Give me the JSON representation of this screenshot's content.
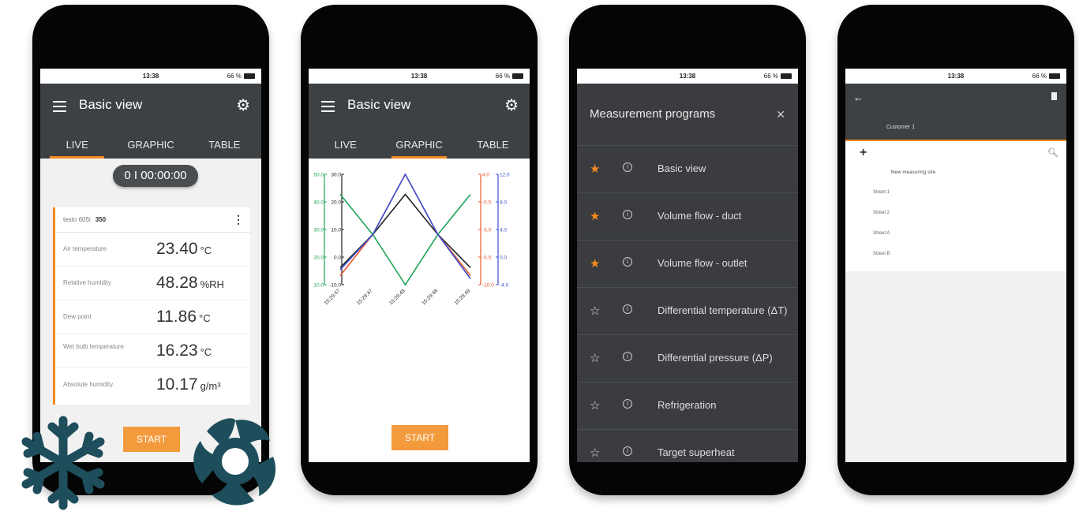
{
  "status": {
    "time": "13:38",
    "battery": "66 %"
  },
  "phone1": {
    "title": "Basic view",
    "tabs": [
      "LIVE",
      "GRAPHIC",
      "TABLE"
    ],
    "timer": "0 I 00:00:00",
    "probe": {
      "name": "testo 605i",
      "serial": "350"
    },
    "readings": [
      {
        "label": "Air temperature",
        "value": "23.40",
        "unit": "°C"
      },
      {
        "label": "Relative humidity",
        "value": "48.28",
        "unit": "%RH"
      },
      {
        "label": "Dew point",
        "value": "11.86",
        "unit": "°C"
      },
      {
        "label": "Wet bulb temperature",
        "value": "16.23",
        "unit": "°C"
      },
      {
        "label": "Absolute humidity",
        "value": "10.17",
        "unit": "g/m³"
      }
    ],
    "start_label": "START"
  },
  "phone2": {
    "title": "Basic view",
    "tabs": [
      "LIVE",
      "GRAPHIC",
      "TABLE"
    ],
    "start_label": "START",
    "chart_data": {
      "type": "line",
      "x": [
        "15:29:47",
        "15:29:47",
        "15:29:48",
        "15:29:48",
        "15:29:49"
      ],
      "axes": [
        {
          "ticks": [
            "50.0",
            "40.0",
            "30.0",
            "20.0",
            "10.0"
          ],
          "color": "#1fa35a"
        },
        {
          "ticks": [
            "30.0",
            "20.0",
            "10.0",
            "0.0",
            "-10.0"
          ],
          "color": "#222222"
        },
        {
          "ticks": [
            "4.0",
            "-0.5",
            "-3.0",
            "-5.5",
            "-10.0"
          ],
          "color": "#e8562a"
        },
        {
          "ticks": [
            "12.0",
            "8.0",
            "4.0",
            "0.0",
            "-4.0"
          ],
          "color": "#3b4fd0"
        }
      ],
      "series": [
        {
          "color": "#1fa35a",
          "values": [
            8,
            0,
            -10,
            0,
            8
          ]
        },
        {
          "color": "#222222",
          "values": [
            -6.6,
            0,
            8,
            0,
            -6.6
          ]
        },
        {
          "color": "#e8562a",
          "values": [
            -8.2,
            0,
            12,
            0,
            -8.2
          ]
        },
        {
          "color": "#3b4fd0",
          "values": [
            -7,
            0,
            12,
            0,
            -8.8
          ]
        }
      ],
      "ylim": [
        -10,
        12
      ]
    }
  },
  "phone3": {
    "title": "Measurement programs",
    "items": [
      {
        "label": "Basic view",
        "favorite": true
      },
      {
        "label": "Volume flow - duct",
        "favorite": true
      },
      {
        "label": "Volume flow - outlet",
        "favorite": true
      },
      {
        "label": "Differential temperature (ΔT)",
        "favorite": false
      },
      {
        "label": "Differential pressure (ΔP)",
        "favorite": false
      },
      {
        "label": "Refrigeration",
        "favorite": false
      },
      {
        "label": "Target superheat",
        "favorite": false
      }
    ]
  },
  "phone4": {
    "tab": "Customer 1",
    "new_site": "New measuring site",
    "sites": [
      "Street 1",
      "Street 2",
      "Street A",
      "Street B"
    ]
  },
  "colors": {
    "accent": "#f28a1f",
    "appbar": "#3e4144",
    "deco": "#1e4e5c"
  }
}
